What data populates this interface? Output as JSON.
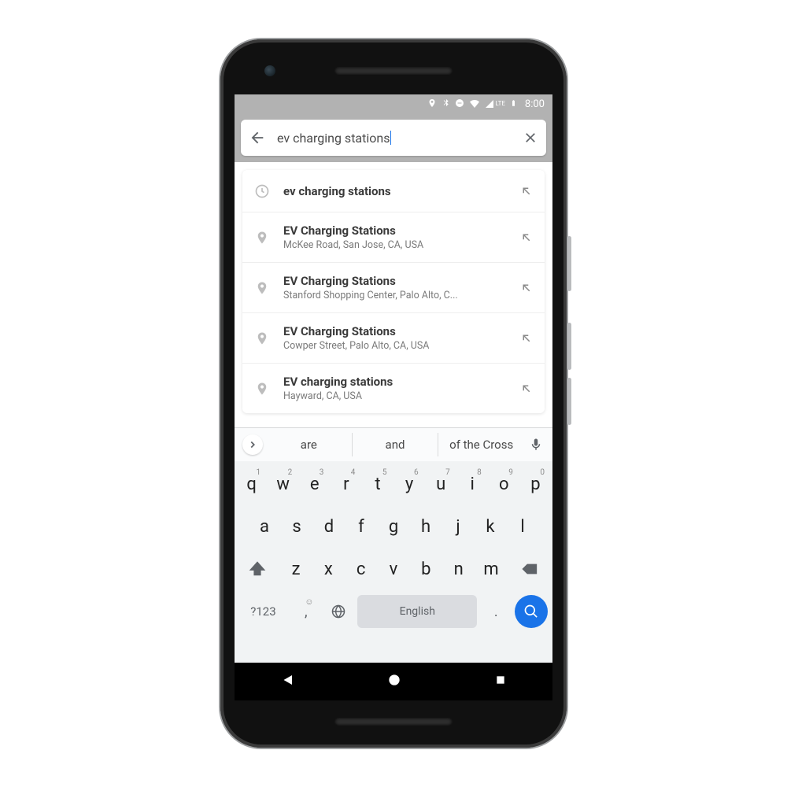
{
  "status": {
    "time": "8:00",
    "lte": "LTE"
  },
  "search": {
    "query": "ev charging stations"
  },
  "suggestions": [
    {
      "icon": "clock",
      "title": "ev charging stations",
      "subtitle": ""
    },
    {
      "icon": "pin",
      "title": "EV Charging Stations",
      "subtitle": "McKee Road, San Jose, CA, USA"
    },
    {
      "icon": "pin",
      "title": "EV Charging Stations",
      "subtitle": "Stanford Shopping Center, Palo Alto, C..."
    },
    {
      "icon": "pin",
      "title": "EV Charging Stations",
      "subtitle": "Cowper Street, Palo Alto, CA, USA"
    },
    {
      "icon": "pin",
      "title": "EV charging stations",
      "subtitle": "Hayward, CA, USA"
    }
  ],
  "keyboard": {
    "text_suggestions": [
      "are",
      "and",
      "of the Cross"
    ],
    "row1": [
      {
        "k": "q",
        "n": "1"
      },
      {
        "k": "w",
        "n": "2"
      },
      {
        "k": "e",
        "n": "3"
      },
      {
        "k": "r",
        "n": "4"
      },
      {
        "k": "t",
        "n": "5"
      },
      {
        "k": "y",
        "n": "6"
      },
      {
        "k": "u",
        "n": "7"
      },
      {
        "k": "i",
        "n": "8"
      },
      {
        "k": "o",
        "n": "9"
      },
      {
        "k": "p",
        "n": "0"
      }
    ],
    "row2": [
      "a",
      "s",
      "d",
      "f",
      "g",
      "h",
      "j",
      "k",
      "l"
    ],
    "row3": [
      "z",
      "x",
      "c",
      "v",
      "b",
      "n",
      "m"
    ],
    "symbols_label": "?123",
    "comma_sup": "☺",
    "space_label": "English",
    "period": "."
  }
}
